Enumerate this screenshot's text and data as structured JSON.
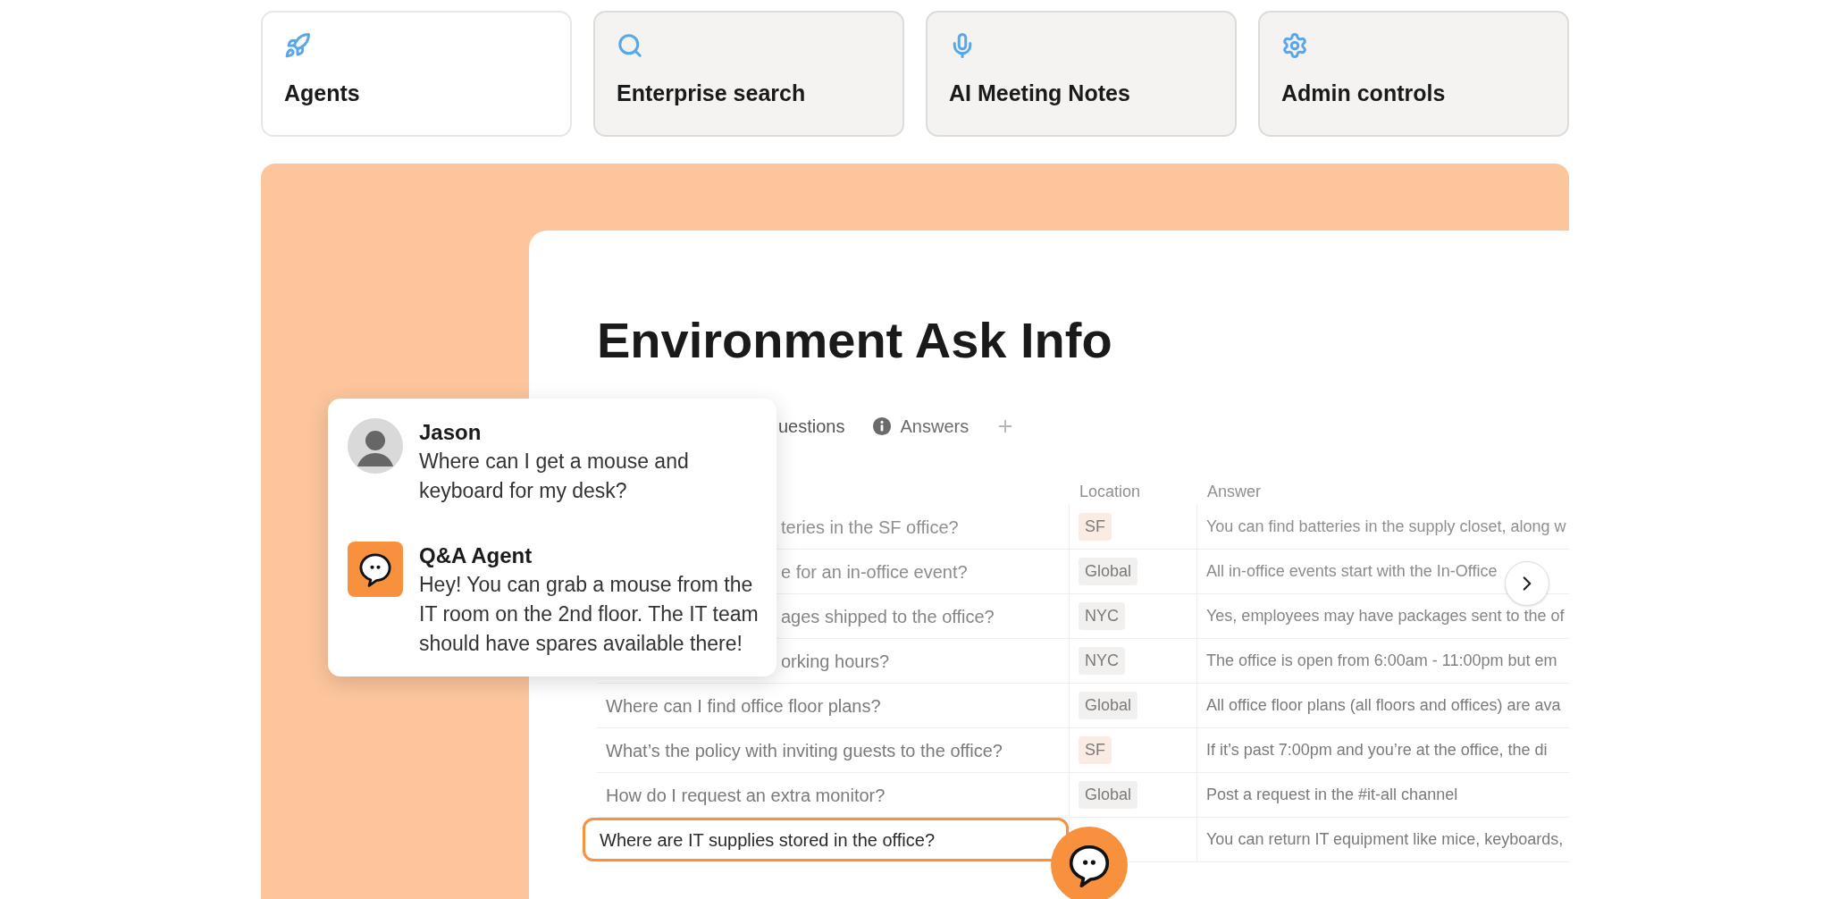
{
  "feature_tabs": [
    {
      "label": "Agents",
      "selected": true
    },
    {
      "label": "Enterprise search",
      "selected": false
    },
    {
      "label": "AI Meeting Notes",
      "selected": false
    },
    {
      "label": "Admin controls",
      "selected": false
    }
  ],
  "page": {
    "title": "Environment Ask Info",
    "views": [
      {
        "label": "uestions",
        "selected": true
      },
      {
        "label": "Answers",
        "selected": false
      }
    ],
    "table": {
      "columns": [
        "Location",
        "Answer"
      ],
      "rows": [
        {
          "question": "teries in the SF office?",
          "kind": "partial",
          "location": "SF",
          "color": "#fbece3",
          "answer": "You can find batteries in the supply closet, along w",
          "selected": false
        },
        {
          "question": "e for an in-office event?",
          "kind": "partial",
          "location": "Global",
          "color": "#f1f0ee",
          "answer": "All in-office events start with the In-Office",
          "selected": false
        },
        {
          "question": "ages shipped to the office?",
          "kind": "partial",
          "location": "NYC",
          "color": "#f1f0ee",
          "answer": "Yes, employees may have packages sent to the of",
          "selected": false
        },
        {
          "question": "orking hours?",
          "kind": "partial",
          "location": "NYC",
          "color": "#f1f0ee",
          "answer": "The office is open from 6:00am - 11:00pm but em",
          "selected": false
        },
        {
          "question": "Where can I find office floor plans?",
          "kind": "full",
          "location": "Global",
          "color": "#f1f0ee",
          "answer": "All office floor plans (all floors and offices) are ava",
          "selected": false
        },
        {
          "question": "What’s the policy with inviting guests to the office?",
          "kind": "full",
          "location": "SF",
          "color": "#fbece3",
          "answer": "If it’s past 7:00pm and you’re at the office, the di",
          "selected": false
        },
        {
          "question": "How do I request an extra monitor?",
          "kind": "full",
          "location": "Global",
          "color": "#f1f0ee",
          "answer": "Post a request in the #it-all channel",
          "selected": false
        },
        {
          "question": "Where are IT supplies stored in the office?",
          "kind": "full",
          "answer": "You can return IT equipment like mice, keyboards,",
          "selected": true
        }
      ]
    }
  },
  "chat": {
    "messages": [
      {
        "sender": "Jason",
        "kind": "user",
        "text": "Where can I get a mouse and keyboard for my desk?"
      },
      {
        "sender": "Q&A Agent",
        "kind": "agent",
        "text": "Hey! You can grab a mouse from the IT room on the 2nd floor. The IT team should have spares available there!"
      }
    ]
  }
}
